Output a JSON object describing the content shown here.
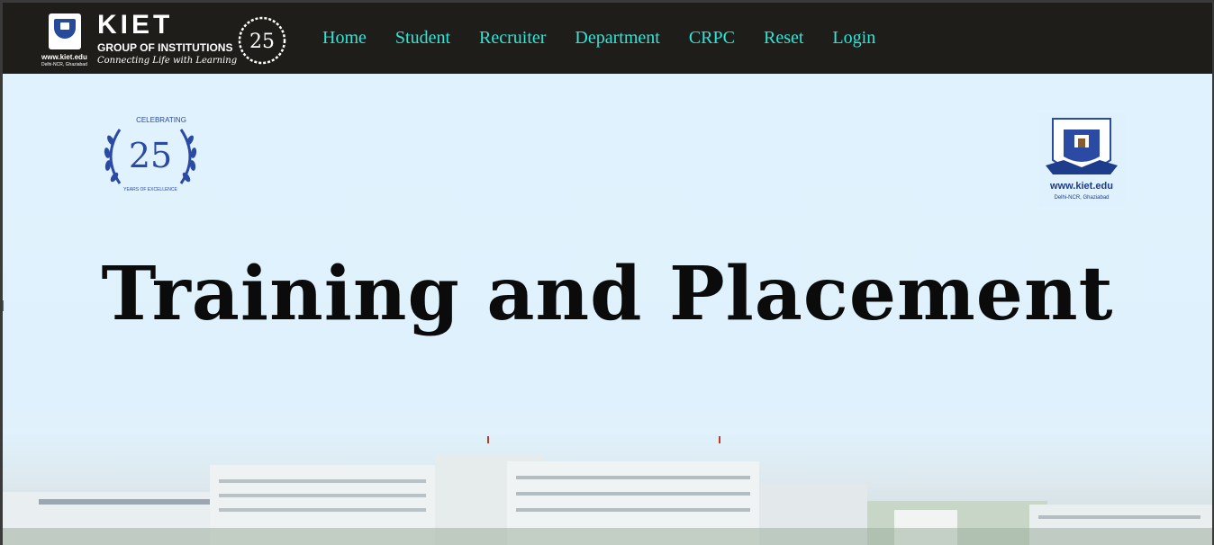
{
  "brand": {
    "name": "KIET",
    "group": "GROUP OF INSTITUTIONS",
    "tagline": "Connecting Life with Learning",
    "website": "www.kiet.edu",
    "location": "Delhi-NCR, Ghaziabad"
  },
  "nav": {
    "links": [
      "Home",
      "Student",
      "Recruiter",
      "Department",
      "CRPC",
      "Reset",
      "Login"
    ]
  },
  "emblem": {
    "number": "25",
    "celebrating": "CELEBRATING",
    "subtitle": "YEARS OF EXCELLENCE"
  },
  "hero": {
    "title": "Training and Placement"
  },
  "colors": {
    "navbar_bg": "#1f1d1a",
    "nav_link": "#2ee6d8",
    "hero_bg": "#e0f2fd",
    "emblem_blue": "#2b4aa3"
  }
}
